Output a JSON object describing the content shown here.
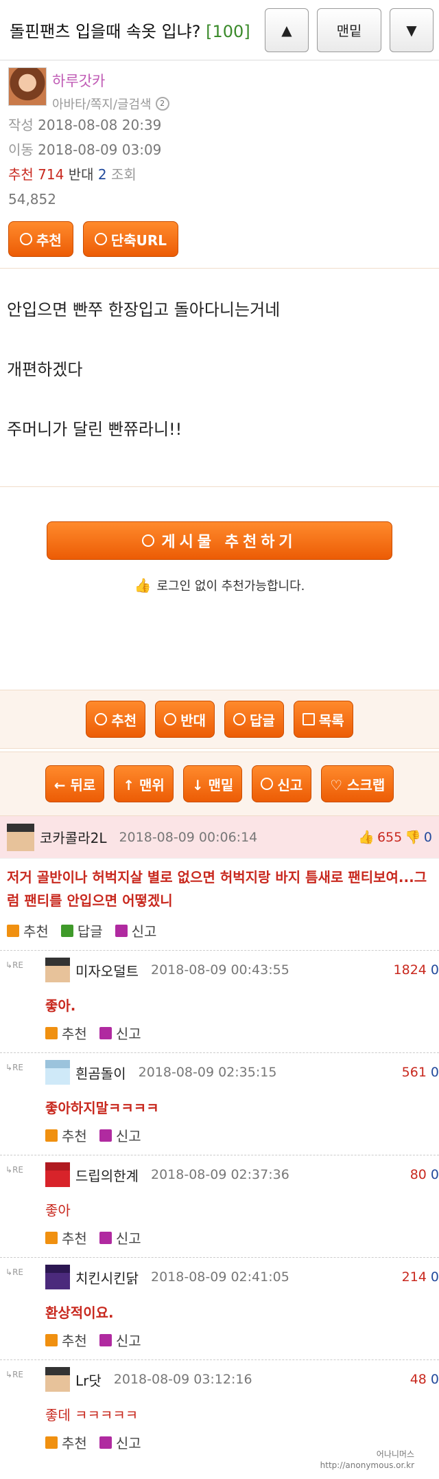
{
  "topbar": {
    "title": "돌핀팬츠 입을때 속옷 입냐?",
    "comment_count": "[100]",
    "up_symbol": "▲",
    "bottom_label": "맨밑",
    "down_symbol": "▼"
  },
  "author": {
    "nickname": "하루갓카",
    "links": "아바타/쪽지/글검색",
    "level": "2",
    "created_label": "작성",
    "created": "2018-08-08 20:39",
    "moved_label": "이동",
    "moved": "2018-08-09 03:09",
    "rec_label": "추천",
    "rec": "714",
    "opp_label": "반대",
    "opp": "2",
    "views_label": "조회",
    "views": "54,852",
    "btn_rec": "추천",
    "btn_url": "단축URL"
  },
  "content": {
    "lines": [
      "안입으면 빤쭈 한장입고 돌아다니는거네",
      "개편하겠다",
      "주머니가 달린 빤쮸라니!!"
    ]
  },
  "recommend": {
    "big_button": "게시물 추천하기",
    "note": "로그인 없이 추천가능합니다."
  },
  "bar1": {
    "rec": "추천",
    "opp": "반대",
    "reply": "답글",
    "list": "목록"
  },
  "bar2": {
    "back": "← 뒤로",
    "top": "↑ 맨위",
    "bottom": "↓ 맨밑",
    "report": "신고",
    "scrap": "♡ 스크랩"
  },
  "comment": {
    "name": "코카콜라2L",
    "date": "2018-08-09 00:06:14",
    "up": "655",
    "down": "0",
    "text": "저거 골반이나 허벅지살 별로 없으면 허벅지랑 바지 틈새로 팬티보여...그럼 팬티를 안입으면 어떻겠니",
    "act_rec": "추천",
    "act_reply": "답글",
    "act_report": "신고"
  },
  "replies": [
    {
      "name": "미자오덜트",
      "date": "2018-08-09 00:43:55",
      "up": "1824",
      "down": "0",
      "text": "좋아.",
      "bold": true,
      "avatar": "man"
    },
    {
      "name": "흰곰돌이",
      "date": "2018-08-09 02:35:15",
      "up": "561",
      "down": "0",
      "text": "좋아하지말ㅋㅋㅋㅋ",
      "bold": true,
      "avatar": "bear"
    },
    {
      "name": "드립의한계",
      "date": "2018-08-09 02:37:36",
      "up": "80",
      "down": "0",
      "text": "좋아",
      "bold": false,
      "avatar": "red"
    },
    {
      "name": "치킨시킨닭",
      "date": "2018-08-09 02:41:05",
      "up": "214",
      "down": "0",
      "text": "환상적이요.",
      "bold": true,
      "avatar": "ninja"
    },
    {
      "name": "Lr닷",
      "date": "2018-08-09 03:12:16",
      "up": "48",
      "down": "0",
      "text": "좋데 ㅋㅋㅋㅋㅋ",
      "bold": false,
      "avatar": "man"
    }
  ],
  "reply_labels": {
    "re": "RE",
    "rec": "추천",
    "report": "신고"
  },
  "watermark": {
    "line1": "어나니머스",
    "line2": "http://anonymous.or.kr"
  }
}
